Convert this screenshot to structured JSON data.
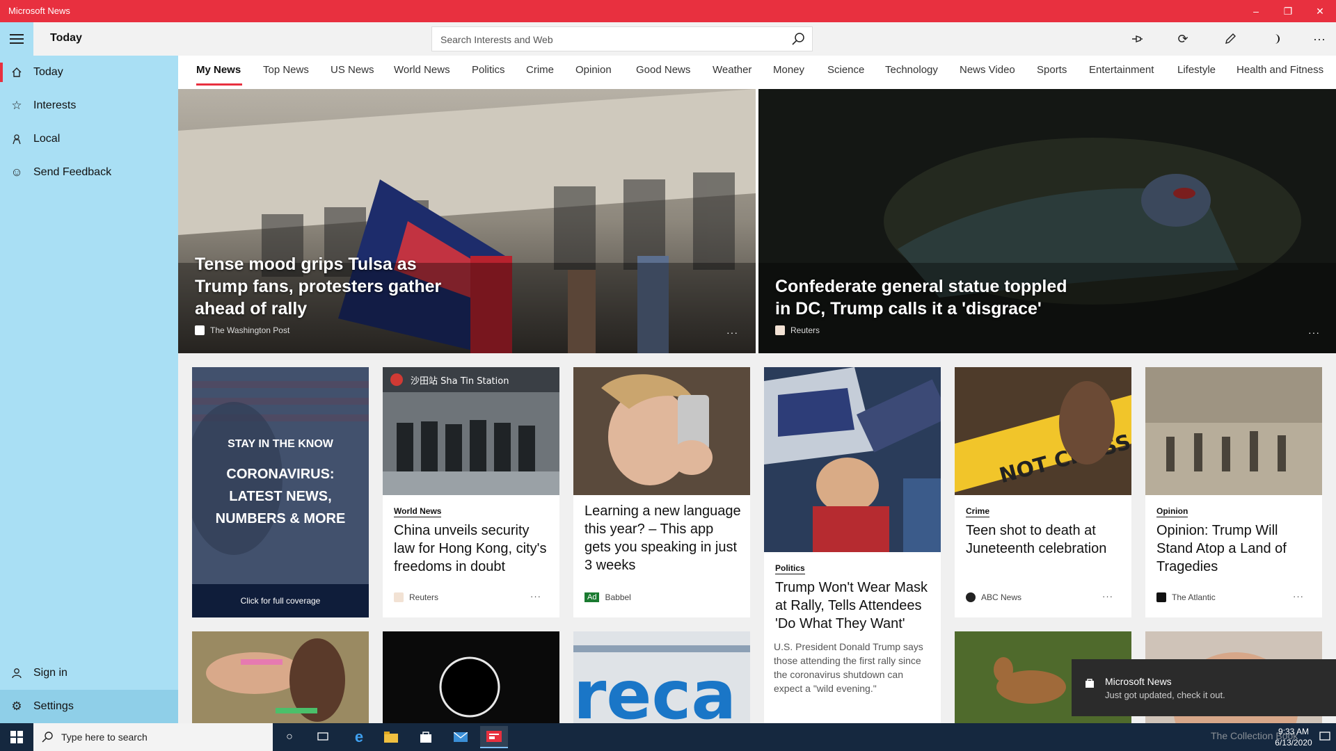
{
  "window": {
    "title": "Microsoft News",
    "minimize": "–",
    "restore": "❐",
    "close": "✕"
  },
  "header": {
    "page_title": "Today",
    "search_placeholder": "Search Interests and Web",
    "more": "···"
  },
  "sidebar": {
    "items": [
      {
        "label": "Today",
        "icon": "home-icon"
      },
      {
        "label": "Interests",
        "icon": "star-list-icon"
      },
      {
        "label": "Local",
        "icon": "person-pin-icon"
      },
      {
        "label": "Send Feedback",
        "icon": "smiley-icon"
      }
    ],
    "bottom": [
      {
        "label": "Sign in",
        "icon": "person-icon"
      },
      {
        "label": "Settings",
        "icon": "gear-icon"
      }
    ]
  },
  "tabs": [
    "My News",
    "Top News",
    "US News",
    "World News",
    "Politics",
    "Crime",
    "Opinion",
    "Good News",
    "Weather",
    "Money",
    "Science",
    "Technology",
    "News Video",
    "Sports",
    "Entertainment",
    "Lifestyle",
    "Health and Fitness"
  ],
  "heroes": [
    {
      "headline": "Tense mood grips Tulsa as Trump fans, protesters gather ahead of rally",
      "source": "The Washington Post",
      "more": "···"
    },
    {
      "headline": "Confederate general statue toppled in DC, Trump calls it a 'disgrace'",
      "source": "Reuters",
      "more": "···"
    }
  ],
  "promo": {
    "kicker": "STAY IN THE KNOW",
    "headline": "CORONAVIRUS: LATEST NEWS, NUMBERS & MORE",
    "cta": "Click for full coverage"
  },
  "cards": [
    {
      "category": "World News",
      "title": "China unveils security law for Hong Kong, city's freedoms in doubt",
      "source": "Reuters",
      "more": "···",
      "station_sign": "沙田站 Sha Tin Station"
    },
    {
      "title": "Learning a new language this year? – This app gets you speaking in just 3 weeks",
      "ad": "Ad",
      "source": "Babbel"
    },
    {
      "category": "Politics",
      "title": "Trump Won't Wear Mask at Rally, Tells Attendees 'Do What They Want'",
      "snippet": "U.S. President Donald Trump says those attending the first rally since the coronavirus shutdown can expect a \"wild evening.\""
    },
    {
      "category": "Crime",
      "title": "Teen shot to death at Juneteenth celebration",
      "source": "ABC News",
      "more": "···"
    },
    {
      "category": "Opinion",
      "title": "Opinion: Trump Will Stand Atop a Land of Tragedies",
      "source": "The Atlantic",
      "more": "···"
    }
  ],
  "toast": {
    "title": "Microsoft News",
    "body": "Just got updated, check it out."
  },
  "taskbar": {
    "search_placeholder": "Type here to search",
    "time": "9:33 AM",
    "date": "6/13/2020"
  },
  "watermark": "The Collection Book",
  "colors": {
    "accent": "#e8303f",
    "sidebar": "#a9dff4",
    "taskbar": "#15283f"
  }
}
